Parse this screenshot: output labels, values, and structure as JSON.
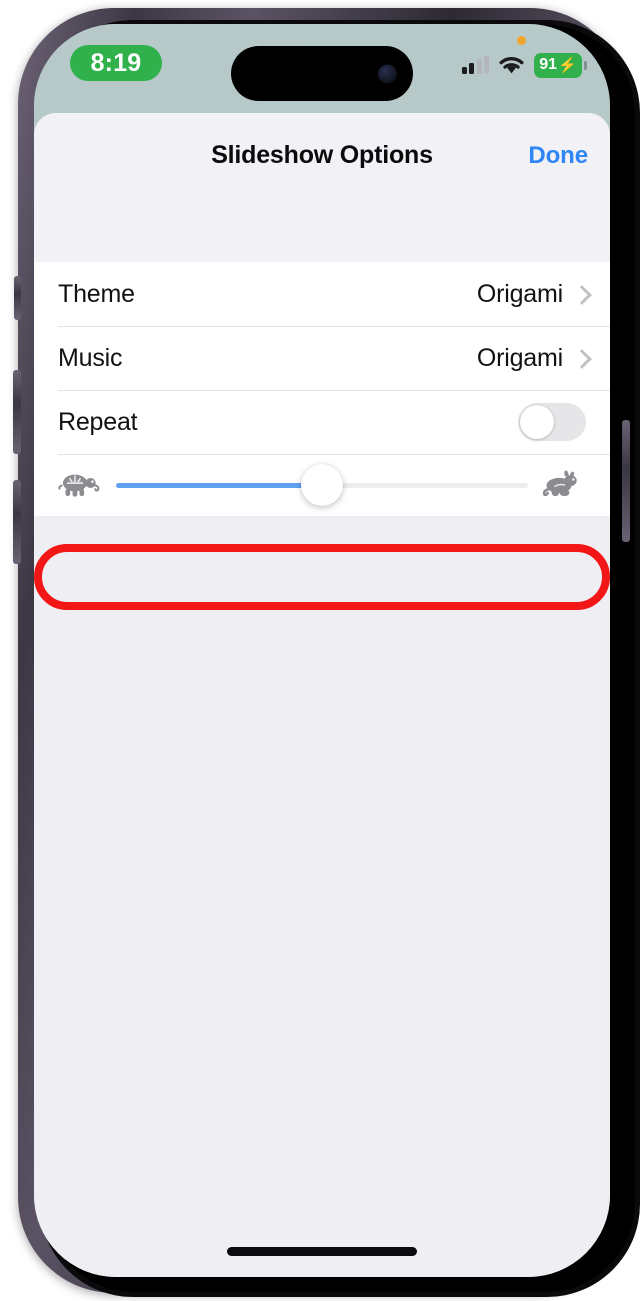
{
  "status_bar": {
    "time": "8:19",
    "battery_percent": "91",
    "battery_bolt": "⚡",
    "icons": [
      "mic-indicator-dot",
      "cellular-signal-icon",
      "wifi-icon",
      "battery-icon"
    ]
  },
  "sheet": {
    "title": "Slideshow Options",
    "done_label": "Done",
    "rows": [
      {
        "label": "Theme",
        "value": "Origami",
        "accessory": "chevron"
      },
      {
        "label": "Music",
        "value": "Origami",
        "accessory": "chevron"
      },
      {
        "label": "Repeat",
        "value": "",
        "accessory": "toggle",
        "toggle_on": false
      }
    ],
    "speed_slider": {
      "left_icon": "tortoise-icon",
      "right_icon": "rabbit-icon",
      "value_percent": 50,
      "fill_color": "#5fa0ef",
      "track_color": "#ededee"
    }
  },
  "annotation": {
    "shape": "rounded-rectangle",
    "color": "#f21616",
    "target": "speed-slider-row"
  }
}
